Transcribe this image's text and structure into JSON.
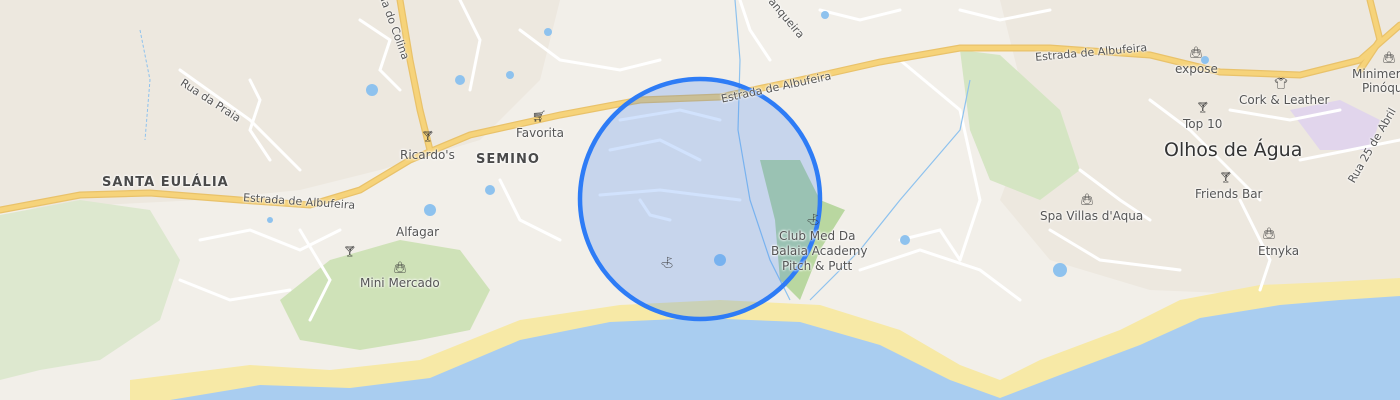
{
  "map": {
    "places": {
      "olhos_de_agua": "Olhos de Água",
      "semino": "SEMINO",
      "santa_eulalia": "SANTA EULÁLIA"
    },
    "roads": {
      "estrada_albufeira_west": "Estrada de Albufeira",
      "estrada_albufeira_center": "Estrada de Albufeira",
      "estrada_albufeira_east": "Estrada de Albufeira",
      "rua_da_praia": "Rua da Praia",
      "rua_25_abril": "Rua 25 de Abril",
      "rua_colina": "Rua do Colina",
      "rua_branqueira": "Branqueira"
    },
    "pois": {
      "ricardos": "Ricardo's",
      "favorita": "Favorita",
      "alfagar": "Alfagar",
      "mini_mercado": "Mini Mercado",
      "club_med_line1": "Club Med Da",
      "club_med_line2": "Balaia Academy",
      "club_med_line3": "Pitch & Putt",
      "spa_villas": "Spa Villas d'Aqua",
      "friends_bar": "Friends Bar",
      "etnyka": "Etnyka",
      "top10": "Top 10",
      "cork_leather": "Cork & Leather",
      "expose": "expose",
      "minimercado_line1": "Minimerc",
      "minimercado_line2": "Pinóqu"
    },
    "icons": {
      "bar": "cocktail-icon",
      "shop": "shopping-bag-icon",
      "cart": "cart-icon",
      "golf": "golf-icon",
      "clothes": "clothes-icon"
    },
    "colors": {
      "land": "#f2efe9",
      "sea": "#a9cdf0",
      "beach": "#f7e9a6",
      "green": "#c9dfb4",
      "road_major": "#f6d37a",
      "road_minor": "#ffffff",
      "accuracy_fill": "#2e7cf6",
      "accuracy_stroke": "#2e7cf6"
    }
  }
}
